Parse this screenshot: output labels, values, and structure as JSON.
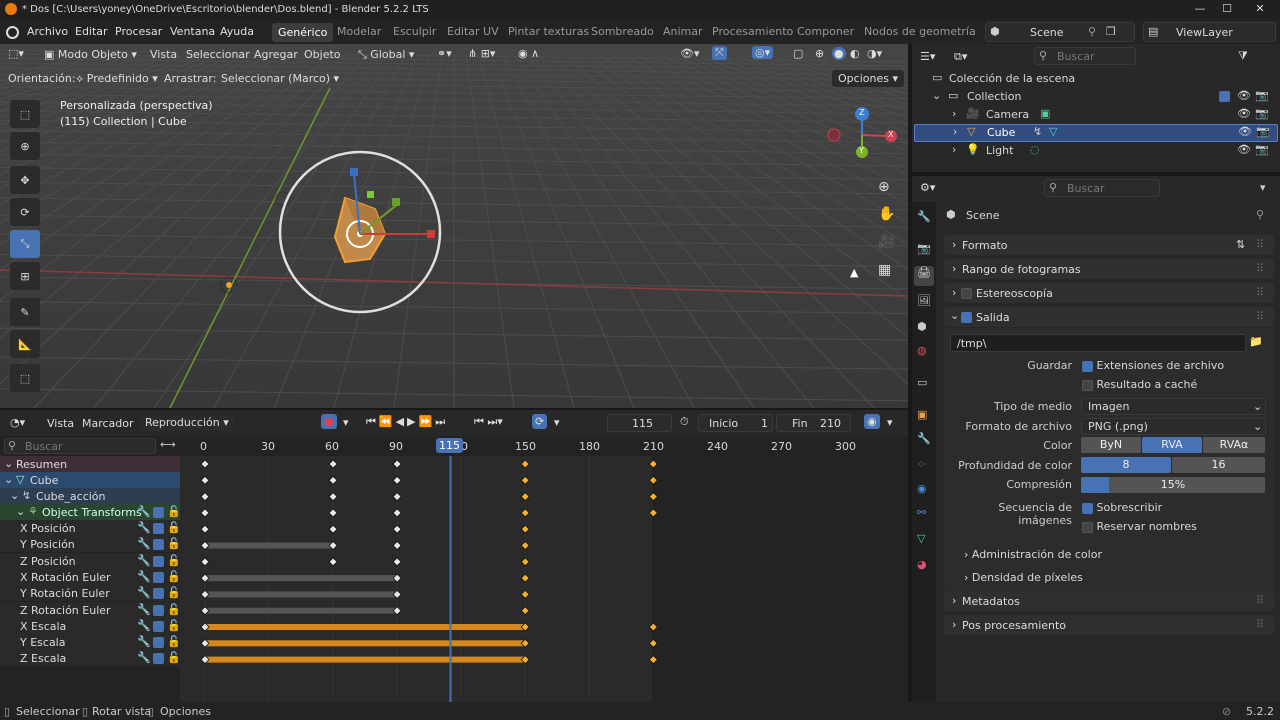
{
  "window": {
    "title": "* Dos [C:\\Users\\yoney\\OneDrive\\Escritorio\\blender\\Dos.blend] - Blender 5.2.2 LTS"
  },
  "menu": {
    "items": [
      "Archivo",
      "Editar",
      "Procesar",
      "Ventana",
      "Ayuda"
    ]
  },
  "workspaces": {
    "tabs": [
      "Genérico",
      "Modelar",
      "Esculpir",
      "Editar UV",
      "Pintar texturas",
      "Sombreado",
      "Animar",
      "Procesamiento",
      "Componer",
      "Nodos de geometría"
    ]
  },
  "scene_selector": {
    "name": "Scene"
  },
  "viewlayer_selector": {
    "name": "ViewLayer"
  },
  "viewport": {
    "header": {
      "mode": "Modo Objeto",
      "view": "Vista",
      "select": "Seleccionar",
      "add": "Agregar",
      "object": "Objeto",
      "transform_orientation": "Global"
    },
    "tool_settings": {
      "orientation_label": "Orientación:",
      "orientation_value": "Predefinido",
      "drag_label": "Arrastrar:",
      "drag_value": "Seleccionar (Marco)",
      "options": "Opciones"
    },
    "overlay_text": {
      "line1": "Personalizada (perspectiva)",
      "line2": "(115) Collection | Cube"
    },
    "gizmo_axes": {
      "x": "X",
      "y": "Y",
      "z": "Z"
    }
  },
  "timeline": {
    "header": {
      "view": "Vista",
      "marker": "Marcador",
      "playback": "Reproducción",
      "current_frame": "115",
      "start_label": "Inicio",
      "start_value": "1",
      "end_label": "Fin",
      "end_value": "210"
    },
    "search_placeholder": "Buscar",
    "ruler": {
      "ticks": [
        "0",
        "30",
        "60",
        "90",
        "150",
        "180",
        "210",
        "240",
        "270",
        "300"
      ],
      "current": "115"
    },
    "channels": {
      "summary": "Resumen",
      "object": "Cube",
      "action": "Cube_acción",
      "group": "Object Transforms",
      "fcurves": [
        "X Posición",
        "Y Posición",
        "Z Posición",
        "X Rotación Euler",
        "Y Rotación Euler",
        "Z Rotación Euler",
        "X Escala",
        "Y Escala",
        "Z Escala"
      ]
    },
    "keyframes": {
      "frames": [
        0,
        60,
        90,
        150,
        210
      ],
      "selected_frames": [
        150,
        210
      ],
      "rows": [
        [
          0,
          60,
          90,
          150,
          210
        ],
        [
          0,
          60,
          90,
          150,
          210
        ],
        [
          0,
          60,
          90,
          150,
          210
        ],
        [
          0,
          60,
          90,
          150,
          210
        ],
        [
          0,
          60,
          90,
          150
        ],
        [
          0,
          60,
          90,
          150
        ],
        [
          0,
          60,
          90,
          150
        ],
        [
          0,
          90,
          150
        ],
        [
          0,
          90,
          150
        ],
        [
          0,
          90,
          150
        ],
        [
          0,
          150,
          210
        ],
        [
          0,
          150,
          210
        ],
        [
          0,
          150,
          210
        ]
      ],
      "holds": [
        {
          "row": 5,
          "from": 0,
          "to": 60,
          "color": "#555555"
        },
        {
          "row": 7,
          "from": 0,
          "to": 90,
          "color": "#555555"
        },
        {
          "row": 8,
          "from": 0,
          "to": 90,
          "color": "#555555"
        },
        {
          "row": 9,
          "from": 0,
          "to": 90,
          "color": "#555555"
        },
        {
          "row": 10,
          "from": 0,
          "to": 150,
          "color": "#d4891c"
        },
        {
          "row": 11,
          "from": 0,
          "to": 150,
          "color": "#d4891c"
        },
        {
          "row": 12,
          "from": 0,
          "to": 150,
          "color": "#d4891c"
        }
      ]
    }
  },
  "outliner": {
    "search_placeholder": "Buscar",
    "root": "Colección de la escena",
    "collection": "Collection",
    "items": [
      "Camera",
      "Cube",
      "Light"
    ]
  },
  "properties": {
    "search_placeholder": "Buscar",
    "context": "Scene",
    "panels": {
      "format": "Formato",
      "frame_range": "Rango de fotogramas",
      "stereoscopy": "Estereoscopía",
      "output": "Salida",
      "metadata": "Metadatos",
      "post": "Pos procesamiento"
    },
    "output": {
      "path": "/tmp\\",
      "save_label": "Guardar",
      "file_ext": "Extensiones de archivo",
      "cache_result": "Resultado a caché",
      "media_type_label": "Tipo de medio",
      "media_type": "Imagen",
      "file_format_label": "Formato de archivo",
      "file_format": "PNG (.png)",
      "color_label": "Color",
      "color_modes": [
        "ByN",
        "RVA",
        "RVAα"
      ],
      "color_active": "RVA",
      "depth_label": "Profundidad de color",
      "depth_options": [
        "8",
        "16"
      ],
      "depth_active": "8",
      "compression_label": "Compresión",
      "compression": "15%",
      "compression_fraction": 0.15,
      "sequence_label": "Secuencia de imágenes",
      "overwrite": "Sobrescribir",
      "placeholders": "Reservar nombres",
      "color_management": "Administración de color",
      "pixel_density": "Densidad de píxeles"
    }
  },
  "statusbar": {
    "select": "Seleccionar",
    "rotate": "Rotar vista",
    "options": "Opciones",
    "version": "5.2.2"
  },
  "colors": {
    "accent": "#4772b3",
    "keyframe_selected": "#f0b030",
    "hold_orange": "#d4891c",
    "x_axis": "#c53b45",
    "y_axis": "#6a9e2b",
    "z_axis": "#3a6fc4"
  }
}
